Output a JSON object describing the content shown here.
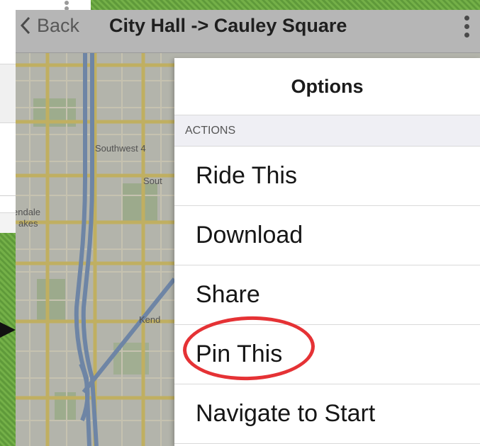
{
  "nav": {
    "back_label": "Back",
    "title": "City Hall -> Cauley Square"
  },
  "map": {
    "labels": [
      "Southwest 4",
      "Sout",
      "endale",
      "akes",
      "Kend"
    ]
  },
  "options": {
    "title": "Options",
    "section_header": "ACTIONS",
    "items": [
      {
        "label": "Ride This"
      },
      {
        "label": "Download"
      },
      {
        "label": "Share"
      },
      {
        "label": "Pin This",
        "highlighted": true
      },
      {
        "label": "Navigate to Start"
      }
    ]
  },
  "colors": {
    "highlight_ring": "#e53235",
    "nav_bar": "#b6b6b6",
    "section_header_bg": "#efeff4",
    "backdrop_green": "#74b048"
  },
  "icons": {
    "back": "chevron-left-icon",
    "more": "more-vertical-icon",
    "pointer": "arrow-right-icon"
  }
}
